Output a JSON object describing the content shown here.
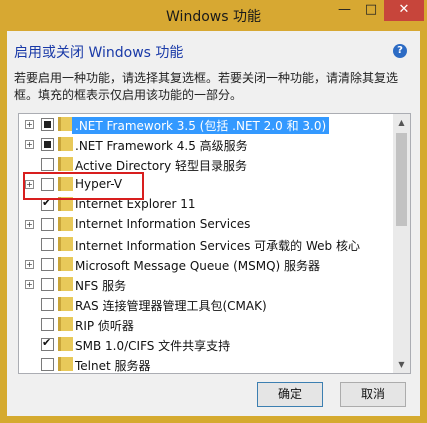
{
  "window": {
    "title": "Windows 功能"
  },
  "titlebar": {
    "minimize_glyph": "—",
    "maximize_glyph": "□",
    "close_glyph": "✕"
  },
  "heading": "启用或关闭 Windows 功能",
  "help_icon": "?",
  "description": "若要启用一种功能，请选择其复选框。若要关闭一种功能，请清除其复选框。填充的框表示仅启用该功能的一部分。",
  "features": [
    {
      "label": ".NET Framework 3.5 (包括 .NET 2.0 和 3.0)",
      "expandable": true,
      "state": "partial",
      "selected": true
    },
    {
      "label": ".NET Framework 4.5 高级服务",
      "expandable": true,
      "state": "partial"
    },
    {
      "label": "Active Directory 轻型目录服务",
      "expandable": false,
      "state": "unchecked"
    },
    {
      "label": "Hyper-V",
      "expandable": true,
      "state": "unchecked",
      "highlighted": true
    },
    {
      "label": "Internet Explorer 11",
      "expandable": false,
      "state": "checked"
    },
    {
      "label": "Internet Information Services",
      "expandable": true,
      "state": "unchecked"
    },
    {
      "label": "Internet Information Services 可承载的 Web 核心",
      "expandable": false,
      "state": "unchecked"
    },
    {
      "label": "Microsoft Message Queue (MSMQ) 服务器",
      "expandable": true,
      "state": "unchecked"
    },
    {
      "label": "NFS 服务",
      "expandable": true,
      "state": "unchecked"
    },
    {
      "label": "RAS 连接管理器管理工具包(CMAK)",
      "expandable": false,
      "state": "unchecked"
    },
    {
      "label": "RIP 侦听器",
      "expandable": false,
      "state": "unchecked"
    },
    {
      "label": "SMB 1.0/CIFS 文件共享支持",
      "expandable": false,
      "state": "checked"
    },
    {
      "label": "Telnet 服务器",
      "expandable": false,
      "state": "unchecked"
    }
  ],
  "buttons": {
    "ok": "确定",
    "cancel": "取消"
  },
  "colors": {
    "accent_title": "#d7a832",
    "heading": "#1a3aa8",
    "highlight_box": "#d81e1e",
    "selection": "#3399ff"
  }
}
